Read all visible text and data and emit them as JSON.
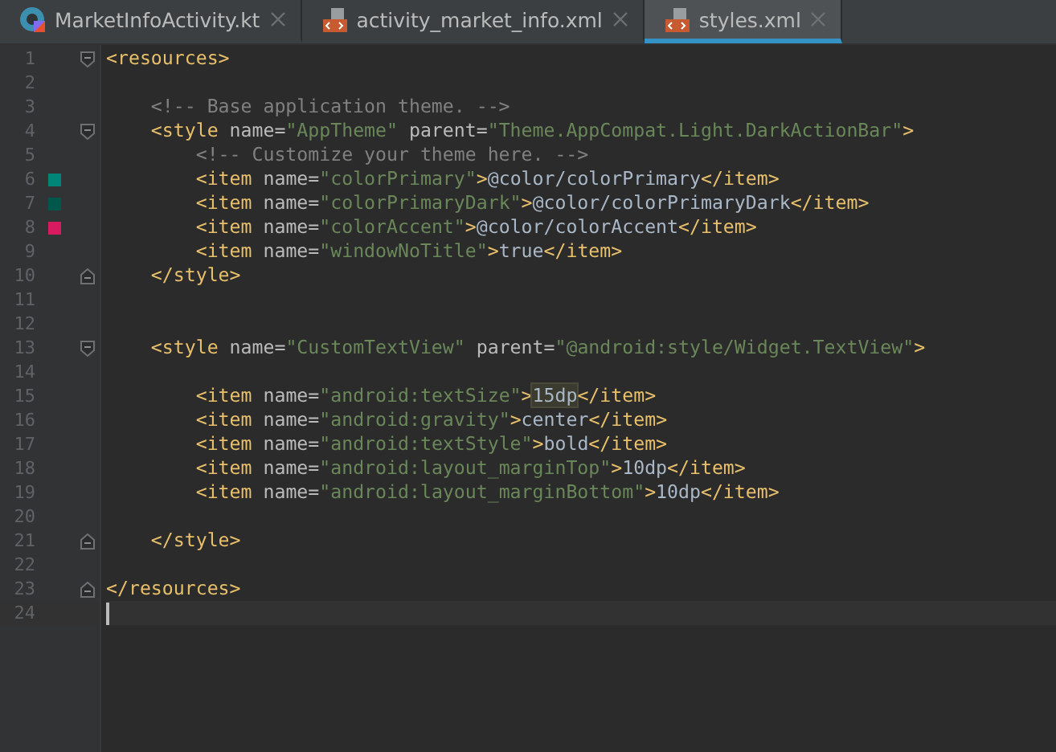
{
  "tabs": [
    {
      "label": "MarketInfoActivity.kt",
      "kind": "kotlin",
      "selected": false
    },
    {
      "label": "activity_market_info.xml",
      "kind": "xml",
      "selected": false
    },
    {
      "label": "styles.xml",
      "kind": "xml",
      "selected": true
    }
  ],
  "editor": {
    "lines": [
      {
        "number": "1",
        "kind": "foldstart",
        "tokens": [
          {
            "kind": "tag",
            "text": "<resources>"
          }
        ]
      },
      {
        "number": "2",
        "kind": "plain"
      },
      {
        "number": "3",
        "kind": "plain",
        "tokens": [
          {
            "kind": "comment",
            "text": "    <!-- Base application theme. -->"
          }
        ]
      },
      {
        "number": "4",
        "kind": "foldstart",
        "tokens": [
          {
            "kind": "tag",
            "text": "    <style "
          },
          {
            "kind": "attr",
            "text": "name="
          },
          {
            "kind": "string",
            "text": "\"AppTheme\" "
          },
          {
            "kind": "attr",
            "text": "parent="
          },
          {
            "kind": "string",
            "text": "\"Theme.AppCompat.Light.DarkActionBar\""
          },
          {
            "kind": "tag",
            "text": ">"
          }
        ]
      },
      {
        "number": "5",
        "kind": "plain",
        "tokens": [
          {
            "kind": "comment",
            "text": "        <!-- Customize your theme here. -->"
          }
        ]
      },
      {
        "number": "6",
        "kind": "plain",
        "color": "#008577",
        "tokens": [
          {
            "kind": "tag",
            "text": "        <item "
          },
          {
            "kind": "attr",
            "text": "name="
          },
          {
            "kind": "string",
            "text": "\"colorPrimary\""
          },
          {
            "kind": "tag",
            "text": ">"
          },
          {
            "kind": "text",
            "text": "@color/colorPrimary"
          },
          {
            "kind": "tag",
            "text": "</item>"
          }
        ]
      },
      {
        "number": "7",
        "kind": "plain",
        "color": "#00574b",
        "tokens": [
          {
            "kind": "tag",
            "text": "        <item "
          },
          {
            "kind": "attr",
            "text": "name="
          },
          {
            "kind": "string",
            "text": "\"colorPrimaryDark\""
          },
          {
            "kind": "tag",
            "text": ">"
          },
          {
            "kind": "text",
            "text": "@color/colorPrimaryDark"
          },
          {
            "kind": "tag",
            "text": "</item>"
          }
        ]
      },
      {
        "number": "8",
        "kind": "plain",
        "color": "#d81b60",
        "tokens": [
          {
            "kind": "tag",
            "text": "        <item "
          },
          {
            "kind": "attr",
            "text": "name="
          },
          {
            "kind": "string",
            "text": "\"colorAccent\""
          },
          {
            "kind": "tag",
            "text": ">"
          },
          {
            "kind": "text",
            "text": "@color/colorAccent"
          },
          {
            "kind": "tag",
            "text": "</item>"
          }
        ]
      },
      {
        "number": "9",
        "kind": "plain",
        "tokens": [
          {
            "kind": "tag",
            "text": "        <item "
          },
          {
            "kind": "attr",
            "text": "name="
          },
          {
            "kind": "string",
            "text": "\"windowNoTitle\""
          },
          {
            "kind": "tag",
            "text": ">"
          },
          {
            "kind": "text",
            "text": "true"
          },
          {
            "kind": "tag",
            "text": "</item>"
          }
        ]
      },
      {
        "number": "10",
        "kind": "foldend",
        "tokens": [
          {
            "kind": "tag",
            "text": "    </style>"
          }
        ]
      },
      {
        "number": "11",
        "kind": "plain"
      },
      {
        "number": "12",
        "kind": "plain"
      },
      {
        "number": "13",
        "kind": "foldstart",
        "tokens": [
          {
            "kind": "tag",
            "text": "    <style "
          },
          {
            "kind": "attr",
            "text": "name="
          },
          {
            "kind": "string",
            "text": "\"CustomTextView\" "
          },
          {
            "kind": "attr",
            "text": "parent="
          },
          {
            "kind": "string",
            "text": "\"@android:style/Widget.TextView\""
          },
          {
            "kind": "tag",
            "text": ">"
          }
        ]
      },
      {
        "number": "14",
        "kind": "plain"
      },
      {
        "number": "15",
        "kind": "plain",
        "tokens": [
          {
            "kind": "tag",
            "text": "        <item "
          },
          {
            "kind": "attr",
            "text": "name="
          },
          {
            "kind": "string",
            "text": "\"android:textSize\""
          },
          {
            "kind": "tag",
            "text": ">"
          },
          {
            "kind": "text",
            "text": "15dp",
            "highlighted": true
          },
          {
            "kind": "tag",
            "text": "</item>"
          }
        ]
      },
      {
        "number": "16",
        "kind": "plain",
        "tokens": [
          {
            "kind": "tag",
            "text": "        <item "
          },
          {
            "kind": "attr",
            "text": "name="
          },
          {
            "kind": "string",
            "text": "\"android:gravity\""
          },
          {
            "kind": "tag",
            "text": ">"
          },
          {
            "kind": "text",
            "text": "center"
          },
          {
            "kind": "tag",
            "text": "</item>"
          }
        ]
      },
      {
        "number": "17",
        "kind": "plain",
        "tokens": [
          {
            "kind": "tag",
            "text": "        <item "
          },
          {
            "kind": "attr",
            "text": "name="
          },
          {
            "kind": "string",
            "text": "\"android:textStyle\""
          },
          {
            "kind": "tag",
            "text": ">"
          },
          {
            "kind": "text",
            "text": "bold"
          },
          {
            "kind": "tag",
            "text": "</item>"
          }
        ]
      },
      {
        "number": "18",
        "kind": "plain",
        "tokens": [
          {
            "kind": "tag",
            "text": "        <item "
          },
          {
            "kind": "attr",
            "text": "name="
          },
          {
            "kind": "string",
            "text": "\"android:layout_marginTop\""
          },
          {
            "kind": "tag",
            "text": ">"
          },
          {
            "kind": "text",
            "text": "10dp"
          },
          {
            "kind": "tag",
            "text": "</item>"
          }
        ]
      },
      {
        "number": "19",
        "kind": "plain",
        "tokens": [
          {
            "kind": "tag",
            "text": "        <item "
          },
          {
            "kind": "attr",
            "text": "name="
          },
          {
            "kind": "string",
            "text": "\"android:layout_marginBottom\""
          },
          {
            "kind": "tag",
            "text": ">"
          },
          {
            "kind": "text",
            "text": "10dp"
          },
          {
            "kind": "tag",
            "text": "</item>"
          }
        ]
      },
      {
        "number": "20",
        "kind": "plain"
      },
      {
        "number": "21",
        "kind": "foldend",
        "tokens": [
          {
            "kind": "tag",
            "text": "    </style>"
          }
        ]
      },
      {
        "number": "22",
        "kind": "plain"
      },
      {
        "number": "23",
        "kind": "foldend",
        "tokens": [
          {
            "kind": "tag",
            "text": "</resources>"
          }
        ]
      },
      {
        "number": "24",
        "kind": "plain",
        "current": true
      }
    ]
  }
}
